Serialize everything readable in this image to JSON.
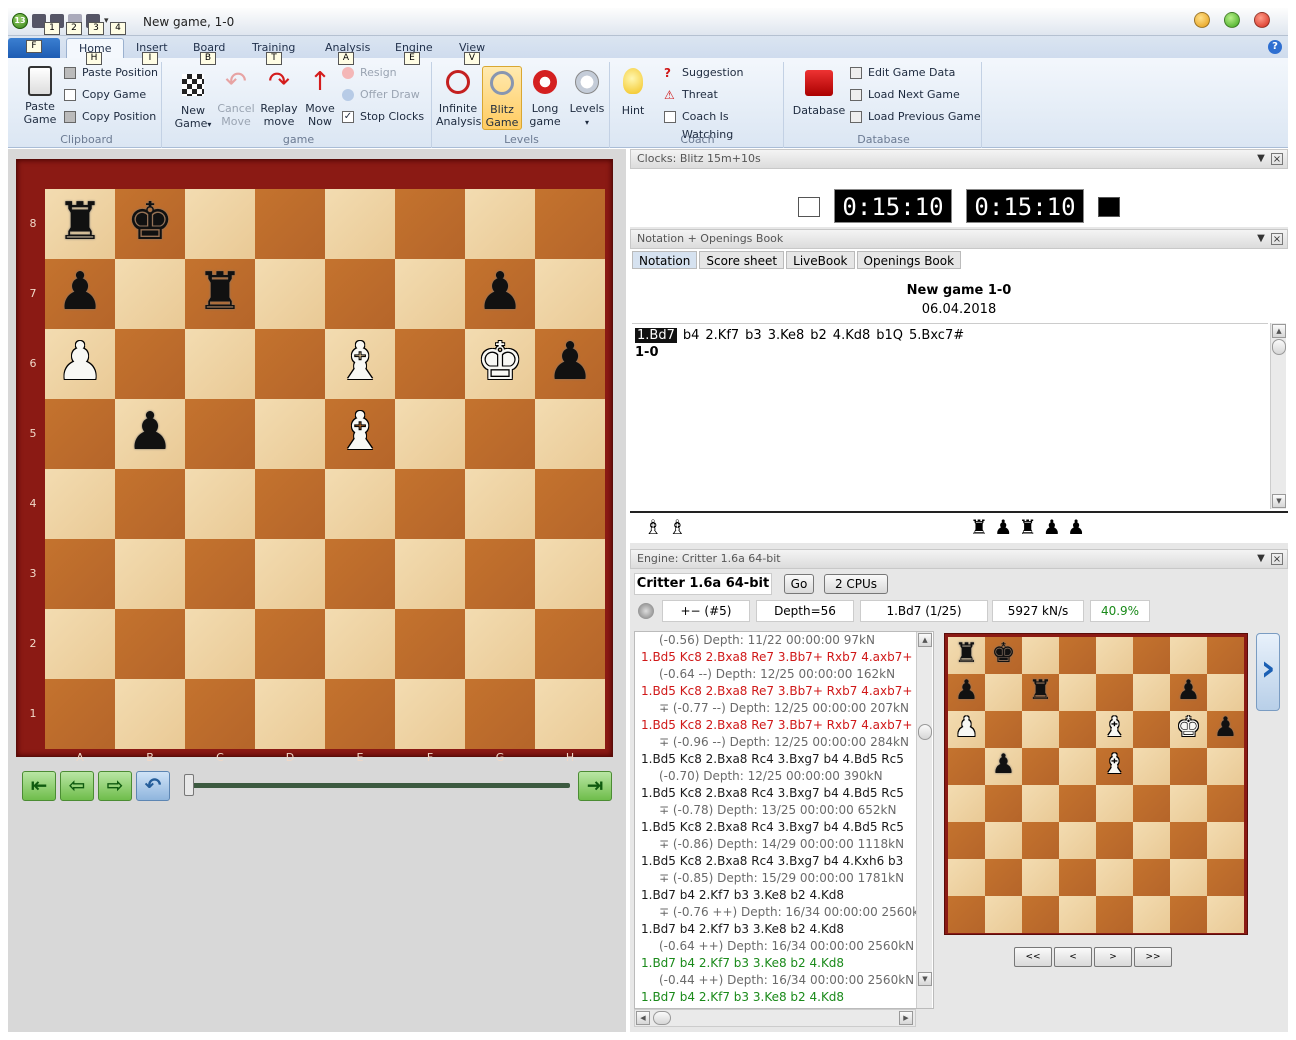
{
  "window": {
    "title": "New game, 1-0",
    "app_badge": "13"
  },
  "keytips": [
    "1",
    "2",
    "3",
    "4",
    "F",
    "H",
    "I",
    "B",
    "T",
    "A",
    "E",
    "V"
  ],
  "ribbon": {
    "file_tab": "",
    "tabs": [
      "Home",
      "Insert",
      "Board",
      "Training",
      "Analysis",
      "Engine",
      "View"
    ],
    "active_tab": "Home",
    "groups": {
      "clipboard": {
        "label": "Clipboard",
        "paste": "Paste\nGame",
        "paste_position": "Paste Position",
        "copy_game": "Copy Game",
        "copy_position": "Copy Position"
      },
      "game": {
        "label": "game",
        "new_game": "New\nGame",
        "cancel_move": "Cancel\nMove",
        "replay_move": "Replay\nmove",
        "move_now": "Move\nNow",
        "resign": "Resign",
        "offer_draw": "Offer Draw",
        "stop_clocks": "Stop Clocks"
      },
      "levels": {
        "label": "Levels",
        "infinite": "Infinite\nAnalysis",
        "blitz": "Blitz\nGame",
        "long": "Long\ngame",
        "levels": "Levels"
      },
      "coach": {
        "label": "Coach",
        "hint": "Hint",
        "suggestion": "Suggestion",
        "threat": "Threat",
        "coach_watching": "Coach Is Watching"
      },
      "database": {
        "label": "Database",
        "database": "Database",
        "edit": "Edit Game Data",
        "load_next": "Load Next Game",
        "load_prev": "Load Previous Game"
      }
    }
  },
  "board": {
    "ranks": [
      "8",
      "7",
      "6",
      "5",
      "4",
      "3",
      "2",
      "1"
    ],
    "files": [
      "A",
      "B",
      "C",
      "D",
      "E",
      "F",
      "G",
      "H"
    ],
    "position": [
      [
        "bR",
        "bK",
        "",
        "",
        "",
        "",
        "",
        ""
      ],
      [
        "bP",
        "",
        "bR",
        "",
        "",
        "",
        "bP",
        ""
      ],
      [
        "wP",
        "",
        "",
        "",
        "wB",
        "",
        "wK",
        "bP"
      ],
      [
        "",
        "bP",
        "",
        "",
        "wB",
        "",
        "",
        ""
      ],
      [
        "",
        "",
        "",
        "",
        "",
        "",
        "",
        ""
      ],
      [
        "",
        "",
        "",
        "",
        "",
        "",
        "",
        ""
      ],
      [
        "",
        "",
        "",
        "",
        "",
        "",
        "",
        ""
      ],
      [
        "",
        "",
        "",
        "",
        "",
        "",
        "",
        ""
      ]
    ]
  },
  "navigation": {
    "first": "⇤",
    "prev": "⇦",
    "next": "⇨",
    "undo": "↶",
    "last": "⇥"
  },
  "clocks": {
    "header": "Clocks: Blitz 15m+10s",
    "white": "0:15:10",
    "black": "0:15:10"
  },
  "notation": {
    "header": "Notation + Openings Book",
    "tabs": [
      "Notation",
      "Score sheet",
      "LiveBook",
      "Openings Book"
    ],
    "game_title": "New game  1-0",
    "date": "06.04.2018",
    "moves": [
      "1.Bd7",
      "b4",
      "2.Kf7",
      "b3",
      "3.Ke8",
      "b2",
      "4.Kd8",
      "b1Q",
      "5.Bxc7#"
    ],
    "result": "1-0",
    "material_white": "♗ ♗",
    "material_black": "♜ ♟ ♜ ♟ ♟"
  },
  "engine": {
    "header": "Engine: Critter 1.6a 64-bit",
    "name": "Critter 1.6a 64-bit",
    "go": "Go",
    "cpus": "2 CPUs",
    "eval": "+−  (#5)",
    "depth": "Depth=56",
    "bestmove": "1.Bd7 (1/25)",
    "speed": "5927 kN/s",
    "percent": "40.9%",
    "lines": [
      {
        "t": "info",
        "text": "(-0.56)   Depth: 11/22   00:00:00  97kN"
      },
      {
        "t": "red",
        "text": "1.Bd5 Kc8 2.Bxa8 Re7 3.Bb7+ Rxb7 4.axb7+"
      },
      {
        "t": "info",
        "text": "(-0.64 --)   Depth: 12/25   00:00:00  162kN"
      },
      {
        "t": "red",
        "text": "1.Bd5 Kc8 2.Bxa8 Re7 3.Bb7+ Rxb7 4.axb7+"
      },
      {
        "t": "info",
        "text": "∓  (-0.77 --)   Depth: 12/25   00:00:00  207kN"
      },
      {
        "t": "red",
        "text": "1.Bd5 Kc8 2.Bxa8 Re7 3.Bb7+ Rxb7 4.axb7+"
      },
      {
        "t": "info",
        "text": "∓  (-0.96 --)   Depth: 12/25   00:00:00  284kN"
      },
      {
        "t": "dark",
        "text": "1.Bd5 Kc8 2.Bxa8 Rc4 3.Bxg7 b4 4.Bd5 Rc5"
      },
      {
        "t": "info",
        "text": "(-0.70)   Depth: 12/25   00:00:00  390kN"
      },
      {
        "t": "dark",
        "text": "1.Bd5 Kc8 2.Bxa8 Rc4 3.Bxg7 b4 4.Bd5 Rc5"
      },
      {
        "t": "info",
        "text": "∓  (-0.78)   Depth: 13/25   00:00:00  652kN"
      },
      {
        "t": "dark",
        "text": "1.Bd5 Kc8 2.Bxa8 Rc4 3.Bxg7 b4 4.Bd5 Rc5"
      },
      {
        "t": "info",
        "text": "∓  (-0.86)   Depth: 14/29   00:00:00  1118kN"
      },
      {
        "t": "dark",
        "text": "1.Bd5 Kc8 2.Bxa8 Rc4 3.Bxg7 b4 4.Kxh6 b3"
      },
      {
        "t": "info",
        "text": "∓  (-0.85)   Depth: 15/29   00:00:00  1781kN"
      },
      {
        "t": "dark",
        "text": "1.Bd7 b4 2.Kf7 b3 3.Ke8 b2 4.Kd8"
      },
      {
        "t": "info",
        "text": "∓  (-0.76 ++)   Depth: 16/34   00:00:00  2560kN"
      },
      {
        "t": "dark",
        "text": "1.Bd7 b4 2.Kf7 b3 3.Ke8 b2 4.Kd8"
      },
      {
        "t": "info",
        "text": "(-0.64 ++)   Depth: 16/34   00:00:00  2560kN"
      },
      {
        "t": "green",
        "text": "1.Bd7 b4 2.Kf7 b3 3.Ke8 b2 4.Kd8"
      },
      {
        "t": "info",
        "text": "(-0.44 ++)   Depth: 16/34   00:00:00  2560kN"
      },
      {
        "t": "green",
        "text": "1.Bd7 b4 2.Kf7 b3 3.Ke8 b2 4.Kd8"
      }
    ],
    "mini_nav": [
      "<<",
      "<",
      ">",
      ">>"
    ]
  },
  "colors": {
    "board_frame": "#8b1a14",
    "light_square": "#f0d5a8",
    "dark_square": "#bd6c2c",
    "accent": "#1a5fb4",
    "positive": "#1a8a1a",
    "negative": "#d01818"
  }
}
